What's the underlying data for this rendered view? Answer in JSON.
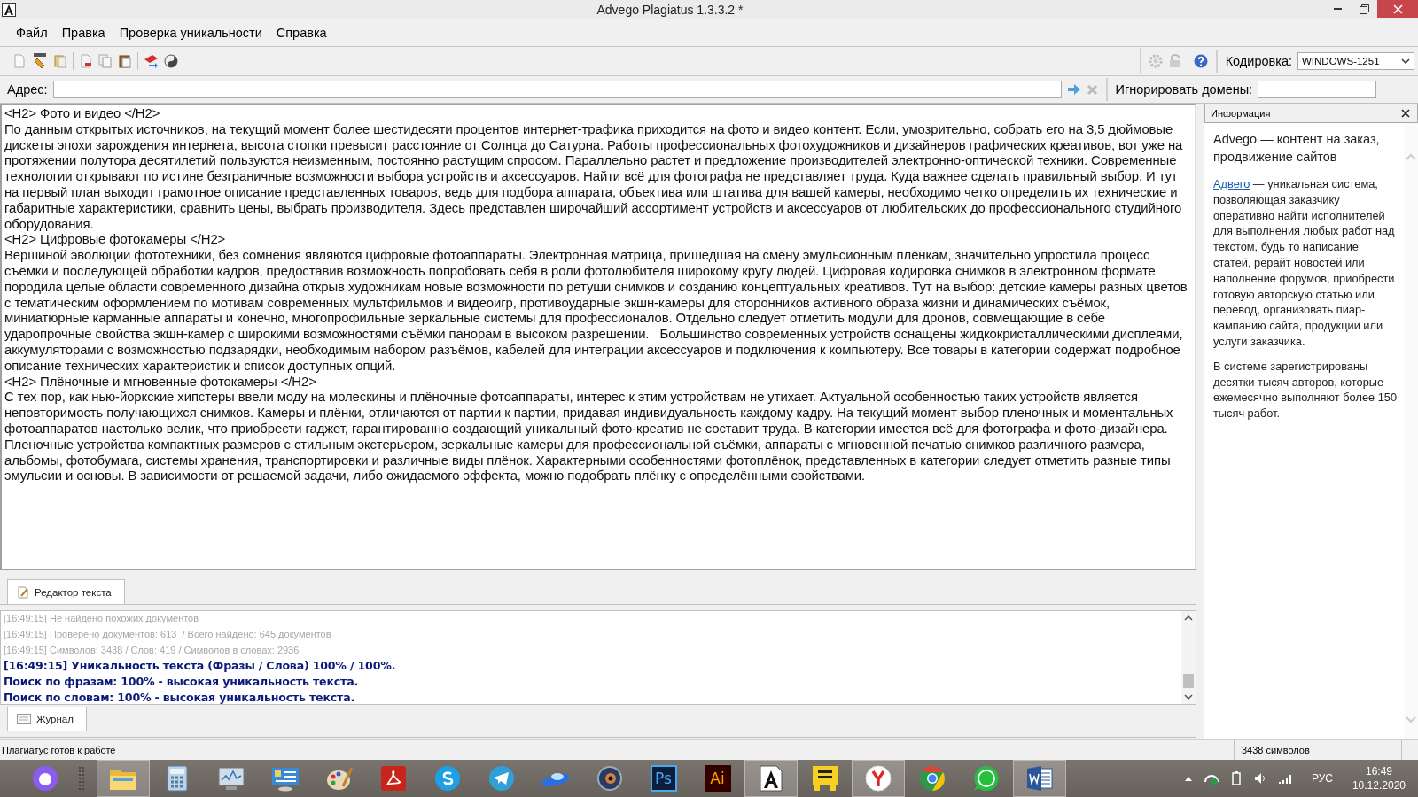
{
  "window": {
    "title": "Advego Plagiatus 1.3.3.2 *"
  },
  "menu": [
    "Файл",
    "Правка",
    "Проверка уникальности",
    "Справка"
  ],
  "toolbar": {
    "encoding_label": "Кодировка:",
    "encoding_value": "WINDOWS-1251"
  },
  "address": {
    "label": "Адрес:",
    "ignore_label": "Игнорировать домены:"
  },
  "editor": {
    "paragraphs": [
      {
        "text": "<H2> Фото и видео </H2>"
      },
      {
        "text": "По данным открытых источников, на текущий момент более шестидесяти процентов интернет-трафика приходится на фото и видео контент. Если, умозрительно, собрать его на 3,5 дюймовые дискеты эпохи зарождения интернета, высота стопки превысит расстояние от Солнца до Сатурна. Работы профессиональных фотохудожников и дизайнеров графических креативов, вот уже на протяжении полутора десятилетий пользуются неизменным, постоянно растущим спросом. Параллельно растет и предложение производителей электронно-оптической техники. Современные технологии открывают по истине безграничные возможности выбора устройств и аксессуаров. Найти всё для фотографа не представляет труда. Куда важнее сделать правильный выбор. И тут на первый план выходит грамотное описание представленных товаров, ведь для подбора аппарата, объектива или штатива для вашей камеры, необходимо четко определить их технические и габаритные характеристики, сравнить цены, выбрать производителя. Здесь представлен широчайший ассортимент устройств и аксессуаров от любительских до профессионального студийного оборудования."
      },
      {
        "text": "<H2> Цифровые фотокамеры </H2>"
      },
      {
        "text": "Вершиной эволюции фототехники, без сомнения являются цифровые фотоаппараты. Электронная матрица, пришедшая на смену эмульсионным плёнкам, значительно упростила процесс съёмки и последующей обработки кадров, предоставив возможность попробовать себя в роли фотолюбителя широкому кругу людей. Цифровая кодировка снимков в электронном формате породила целые области современного дизайна открыв художникам новые возможности по ретуши снимков и созданию концептуальных креативов. Тут на выбор: детские камеры разных цветов с тематическим оформлением по мотивам современных мультфильмов и видеоигр, противоударные экшн-камеры для сторонников активного образа жизни и динамических съёмок, миниатюрные карманные аппараты и конечно, многопрофильные зеркальные системы для профессионалов. Отдельно следует отметить модули для дронов, совмещающие в себе ударопрочные свойства экшн-камер с широкими возможностями съёмки панорам в высоком разрешении.   Большинство современных устройств оснащены жидкокристаллическими дисплеями, аккумуляторами с возможностью подзарядки, необходимым набором разъёмов, кабелей для интеграции аксессуаров и подключения к компьютеру. Все товары в категории содержат подробное описание технических характеристик и список доступных опций."
      },
      {
        "text": "<H2> Плёночные и мгновенные фотокамеры </H2>"
      },
      {
        "text": "С тех пор, как нью-йоркские хипстеры ввели моду на молескины и плёночные фотоаппараты, интерес к этим устройствам не утихает. Актуальной особенностью таких устройств является неповторимость получающихся снимков. Камеры и плёнки, отличаются от партии к партии, придавая индивидуальность каждому кадру. На текущий момент выбор пленочных и моментальных фотоаппаратов настолько велик, что приобрести гаджет, гарантированно создающий уникальный фото-креатив не составит труда. В категории имеется всё для фотографа и фото-дизайнера. Пленочные устройства компактных размеров с стильным экстерьером, зеркальные камеры для профессиональной съёмки, аппараты с мгновенной печатью снимков различного размера, альбомы, фотобумага, системы хранения, транспортировки и различные виды плёнок. Характерными особенностями фотоплёнок, представленных в категории следует отметить разные типы эмульсии и основы. В зависимости от решаемой задачи, либо ожидаемого эффекта, можно подобрать плёнку с определёнными свойствами."
      }
    ],
    "tab": {
      "label": "Редактор текста",
      "selected": true
    }
  },
  "log": {
    "lines": [
      {
        "kind": "muted",
        "text": "[16:49:15] Не найдено похожих документов"
      },
      {
        "kind": "muted",
        "text": "[16:49:15] Проверено документов: 613  / Всего найдено: 645 документов"
      },
      {
        "kind": "muted",
        "text": "[16:49:15] Символов: 3438 / Слов: 419 / Символов в словах: 2936"
      },
      {
        "kind": "result",
        "text": "[16:49:15] Уникальность текста (Фразы / Слова) 100% / 100%."
      },
      {
        "kind": "result",
        "text": "Поиск по фразам: 100% - высокая уникальность текста."
      },
      {
        "kind": "result",
        "text": "Поиск по словам: 100% - высокая уникальность текста."
      }
    ],
    "tab": {
      "label": "Журнал",
      "selected": true
    }
  },
  "info_panel": {
    "title": "Информация",
    "heading": "Advego — контент на заказ, продвижение сайтов",
    "link": "Адвего",
    "text": " — уникальная система, позволяющая заказчику оперативно найти исполнителей для выполнения любых работ над текстом, будь то написание статей, рерайт новостей или наполнение форумов, приобрести готовую авторскую статью или перевод, организовать пиар-кампанию сайта, продукции или услуги заказчика.",
    "text2": "В системе зарегистрированы десятки тысяч авторов, которые ежемесячно выполняют более 150 тысяч работ."
  },
  "status_bar": {
    "message": "Плагиатус готов к работе",
    "count": "3438 символов"
  },
  "taskbar": {
    "apps": [
      {
        "kind": "assistant",
        "active": false
      },
      {
        "kind": "folder",
        "active": true
      },
      {
        "kind": "calculator",
        "active": false
      },
      {
        "kind": "monitor",
        "active": false
      },
      {
        "kind": "panel",
        "active": false
      },
      {
        "kind": "palette",
        "active": false
      },
      {
        "kind": "pdf",
        "active": false
      },
      {
        "kind": "skype",
        "active": false
      },
      {
        "kind": "telegram",
        "active": false
      },
      {
        "kind": "saucer",
        "active": false
      },
      {
        "kind": "eye",
        "active": false
      },
      {
        "kind": "badge",
        "label": "Ps",
        "active": false
      },
      {
        "kind": "badge",
        "label": "Ai",
        "active": false
      },
      {
        "kind": "letter",
        "active": true
      },
      {
        "kind": "bars",
        "active": false
      },
      {
        "kind": "yandex",
        "active": true
      },
      {
        "kind": "chrome",
        "active": false
      },
      {
        "kind": "whatsapp",
        "active": false
      },
      {
        "kind": "word",
        "active": true
      }
    ],
    "lang": "РУС",
    "time": "16:49",
    "date": "10.12.2020"
  }
}
